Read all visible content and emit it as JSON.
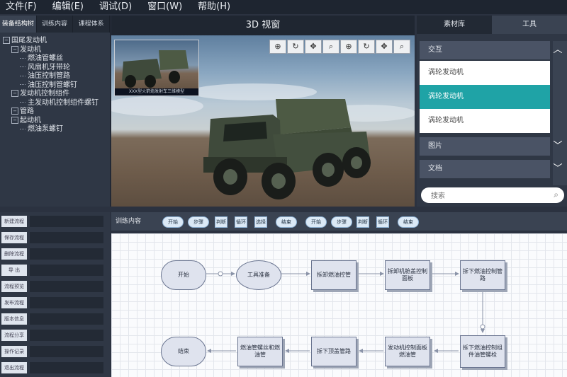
{
  "menubar": [
    "文件(F)",
    "编辑(E)",
    "调试(D)",
    "窗口(W)",
    "帮助(H)"
  ],
  "left_tabs": [
    "装备结构树",
    "训练内容",
    "课程体系"
  ],
  "tree": [
    {
      "label": "国尾发动机",
      "level": 0,
      "toggle": "⊖"
    },
    {
      "label": "发动机",
      "level": 1,
      "toggle": "⊖"
    },
    {
      "label": "燃油管螺丝",
      "level": 2,
      "toggle": ""
    },
    {
      "label": "风扇机牙带轮",
      "level": 2,
      "toggle": ""
    },
    {
      "label": "油压控制管路",
      "level": 2,
      "toggle": ""
    },
    {
      "label": "油压控制管螺钉",
      "level": 2,
      "toggle": ""
    },
    {
      "label": "发动机控制组件",
      "level": 1,
      "toggle": "⊖"
    },
    {
      "label": "主发动机控制组件螺钉",
      "level": 2,
      "toggle": ""
    },
    {
      "label": "管路",
      "level": 1,
      "toggle": "⊖"
    },
    {
      "label": "起动机",
      "level": 1,
      "toggle": "⊖"
    },
    {
      "label": "燃油泵螺钉",
      "level": 2,
      "toggle": ""
    }
  ],
  "viewport": {
    "title": "3D 视窗",
    "thumbnail_caption": "XXX型火箭炮发射车三维模型",
    "tools": [
      "search-zoom-in-icon",
      "rotate-icon",
      "pan-icon",
      "search-icon",
      "search-zoom-in-icon",
      "rotate-icon",
      "pan-icon",
      "search-icon"
    ]
  },
  "right_panel": {
    "tabs": [
      "素材库",
      "工具"
    ],
    "acc1_title": "交互",
    "list_items": [
      "涡轮发动机",
      "涡轮发动机",
      "涡轮发动机"
    ],
    "selected_index": 1,
    "acc2_title": "图片",
    "acc3_title": "文档",
    "search_placeholder": "搜索"
  },
  "bottom_left": [
    "新建流程",
    "保存流程",
    "删除流程",
    "导 出",
    "流程预览",
    "发布流程",
    "版本信息",
    "流程分享",
    "操作记录",
    "退出流程"
  ],
  "bottom_toolbar": {
    "label": "训练内容",
    "buttons": [
      "开始",
      "步骤",
      "判断",
      "循环",
      "选择",
      "结束",
      "开始",
      "步骤",
      "判断",
      "循环",
      "结束"
    ]
  },
  "flowchart": {
    "start": "开始",
    "prep": "工具准备",
    "n1": "拆卸燃油控管",
    "n2": "拆卸机舱盖控制面板",
    "n3": "拆下燃油控制管路",
    "n4": "拆下燃油控制组件油管螺栓",
    "n5": "发动机控制面板燃油管",
    "n6": "拆下顶盖管路",
    "n7": "燃油管螺丝和燃油管",
    "end": "结束"
  },
  "colors": {
    "accent": "#1fa3a6",
    "panel": "#2f3745",
    "header": "#1f2631"
  }
}
